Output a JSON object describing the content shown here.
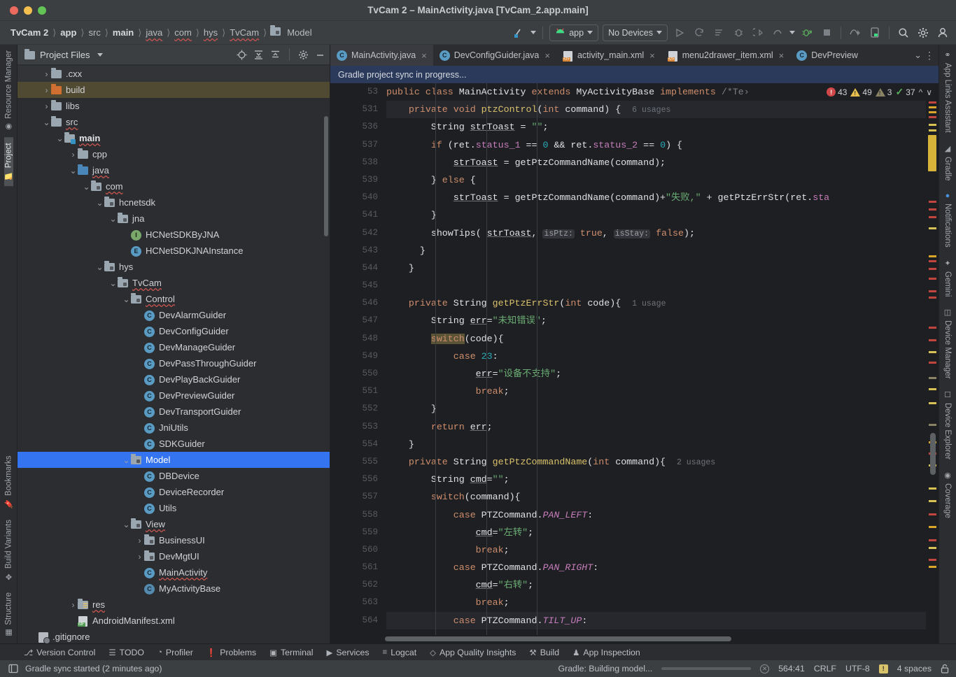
{
  "window": {
    "title": "TvCam 2 – MainActivity.java [TvCam_2.app.main]"
  },
  "breadcrumbs": [
    {
      "label": "TvCam 2",
      "bold": true,
      "squiggle": false
    },
    {
      "label": "app",
      "bold": true,
      "squiggle": false
    },
    {
      "label": "src",
      "bold": false,
      "squiggle": false
    },
    {
      "label": "main",
      "bold": true,
      "squiggle": false
    },
    {
      "label": "java",
      "bold": false,
      "squiggle": true
    },
    {
      "label": "com",
      "bold": false,
      "squiggle": true
    },
    {
      "label": "hys",
      "bold": false,
      "squiggle": true
    },
    {
      "label": "TvCam",
      "bold": false,
      "squiggle": true
    },
    {
      "label": "Model",
      "bold": false,
      "squiggle": false
    }
  ],
  "toolbar": {
    "run_config_label": "app",
    "device_label": "No Devices",
    "icons": [
      "git-branch-icon",
      "run-icon",
      "rerun-icon",
      "run-with-coverage-icon",
      "debug-icon",
      "profile-icon",
      "rollback-icon",
      "attach-debugger-icon",
      "stop-icon",
      "device-mirror-icon",
      "device-screenshot-icon",
      "search-icon",
      "gear-icon",
      "account-icon"
    ]
  },
  "project_panel": {
    "title": "Project Files",
    "header_icons": [
      "locate-icon",
      "expand-all-icon",
      "collapse-all-icon",
      "gear-icon",
      "minimize-icon"
    ],
    "tree": [
      {
        "depth": 3,
        "label": ".cxx",
        "icon": "folder",
        "arrow": "collapsed",
        "state": "hover"
      },
      {
        "depth": 3,
        "label": "build",
        "icon": "folder-orange",
        "arrow": "collapsed",
        "state": "build"
      },
      {
        "depth": 3,
        "label": "libs",
        "icon": "folder",
        "arrow": "collapsed",
        "state": ""
      },
      {
        "depth": 3,
        "label": "src",
        "icon": "folder",
        "arrow": "expanded",
        "state": "",
        "squiggle": true
      },
      {
        "depth": 4,
        "label": "main",
        "icon": "folder-main",
        "arrow": "expanded",
        "state": "",
        "bold": true,
        "squiggle": true
      },
      {
        "depth": 5,
        "label": "cpp",
        "icon": "folder",
        "arrow": "collapsed",
        "state": ""
      },
      {
        "depth": 5,
        "label": "java",
        "icon": "folder-blue",
        "arrow": "expanded",
        "state": "",
        "squiggle": true
      },
      {
        "depth": 6,
        "label": "com",
        "icon": "package",
        "arrow": "expanded",
        "state": "",
        "squiggle": true
      },
      {
        "depth": 7,
        "label": "hcnetsdk",
        "icon": "package",
        "arrow": "expanded",
        "state": ""
      },
      {
        "depth": 8,
        "label": "jna",
        "icon": "package",
        "arrow": "expanded",
        "state": ""
      },
      {
        "depth": 9,
        "label": "HCNetSDKByJNA",
        "icon": "interface",
        "arrow": "none",
        "state": ""
      },
      {
        "depth": 9,
        "label": "HCNetSDKJNAInstance",
        "icon": "enum",
        "arrow": "none",
        "state": ""
      },
      {
        "depth": 7,
        "label": "hys",
        "icon": "package",
        "arrow": "expanded",
        "state": ""
      },
      {
        "depth": 8,
        "label": "TvCam",
        "icon": "package",
        "arrow": "expanded",
        "state": "",
        "squiggle": true
      },
      {
        "depth": 9,
        "label": "Control",
        "icon": "package",
        "arrow": "expanded",
        "state": "",
        "squiggle": true
      },
      {
        "depth": 10,
        "label": "DevAlarmGuider",
        "icon": "class",
        "arrow": "none",
        "state": ""
      },
      {
        "depth": 10,
        "label": "DevConfigGuider",
        "icon": "class",
        "arrow": "none",
        "state": ""
      },
      {
        "depth": 10,
        "label": "DevManageGuider",
        "icon": "class",
        "arrow": "none",
        "state": ""
      },
      {
        "depth": 10,
        "label": "DevPassThroughGuider",
        "icon": "class",
        "arrow": "none",
        "state": ""
      },
      {
        "depth": 10,
        "label": "DevPlayBackGuider",
        "icon": "class",
        "arrow": "none",
        "state": ""
      },
      {
        "depth": 10,
        "label": "DevPreviewGuider",
        "icon": "class",
        "arrow": "none",
        "state": ""
      },
      {
        "depth": 10,
        "label": "DevTransportGuider",
        "icon": "class",
        "arrow": "none",
        "state": ""
      },
      {
        "depth": 10,
        "label": "JniUtils",
        "icon": "class",
        "arrow": "none",
        "state": ""
      },
      {
        "depth": 10,
        "label": "SDKGuider",
        "icon": "class",
        "arrow": "none",
        "state": ""
      },
      {
        "depth": 9,
        "label": "Model",
        "icon": "package",
        "arrow": "expanded",
        "state": "selected"
      },
      {
        "depth": 10,
        "label": "DBDevice",
        "icon": "class",
        "arrow": "none",
        "state": ""
      },
      {
        "depth": 10,
        "label": "DeviceRecorder",
        "icon": "class",
        "arrow": "none",
        "state": ""
      },
      {
        "depth": 10,
        "label": "Utils",
        "icon": "class",
        "arrow": "none",
        "state": ""
      },
      {
        "depth": 9,
        "label": "View",
        "icon": "package",
        "arrow": "expanded",
        "state": "",
        "squiggle": true
      },
      {
        "depth": 10,
        "label": "BusinessUI",
        "icon": "package",
        "arrow": "collapsed",
        "state": ""
      },
      {
        "depth": 10,
        "label": "DevMgtUI",
        "icon": "package",
        "arrow": "collapsed",
        "state": ""
      },
      {
        "depth": 10,
        "label": "MainActivity",
        "icon": "class",
        "arrow": "none",
        "state": "",
        "squiggle": true
      },
      {
        "depth": 10,
        "label": "MyActivityBase",
        "icon": "abstract-class",
        "arrow": "none",
        "state": ""
      },
      {
        "depth": 5,
        "label": "res",
        "icon": "res-folder",
        "arrow": "collapsed",
        "state": "",
        "squiggle": true
      },
      {
        "depth": 5,
        "label": "AndroidManifest.xml",
        "icon": "manifest",
        "arrow": "none",
        "state": ""
      },
      {
        "depth": 2,
        "label": ".gitignore",
        "icon": "gitignore",
        "arrow": "none",
        "state": ""
      }
    ]
  },
  "editor": {
    "tabs": [
      {
        "label": "MainActivity.java",
        "icon": "java-class-icon",
        "active": true,
        "closable": true
      },
      {
        "label": "DevConfigGuider.java",
        "icon": "java-class-icon",
        "active": false,
        "closable": true
      },
      {
        "label": "activity_main.xml",
        "icon": "xml-layout-icon",
        "active": false,
        "closable": true
      },
      {
        "label": "menu2drawer_item.xml",
        "icon": "xml-layout-icon",
        "active": false,
        "closable": true
      },
      {
        "label": "DevPreview",
        "icon": "java-class-icon",
        "active": false,
        "closable": false
      }
    ],
    "tabs_overflow_icon": "chevron-down-icon",
    "tabs_more_icon": "more-options-icon",
    "sync_banner": "Gradle project sync in progress...",
    "inspections": {
      "errors": "43",
      "warnings": "49",
      "weak_warnings": "3",
      "checks": "37"
    },
    "lines": [
      {
        "n": "53",
        "fold": "",
        "hl": false,
        "type": "class_decl"
      },
      {
        "n": "531",
        "fold": "open",
        "hl": true,
        "type": "ptzControl"
      },
      {
        "n": "536",
        "fold": "",
        "hl": false,
        "type": "strToast_decl"
      },
      {
        "n": "537",
        "fold": "open",
        "hl": false,
        "type": "if_ret"
      },
      {
        "n": "538",
        "fold": "",
        "hl": false,
        "type": "assign_cmdname"
      },
      {
        "n": "539",
        "fold": "close",
        "hl": false,
        "type": "else"
      },
      {
        "n": "540",
        "fold": "",
        "hl": false,
        "type": "assign_fail"
      },
      {
        "n": "541",
        "fold": "close",
        "hl": false,
        "type": "brace"
      },
      {
        "n": "542",
        "fold": "",
        "hl": false,
        "type": "showtips"
      },
      {
        "n": "543",
        "fold": "close",
        "hl": false,
        "type": "brace2"
      },
      {
        "n": "544",
        "fold": "close",
        "hl": false,
        "type": "brace3"
      },
      {
        "n": "545",
        "fold": "",
        "hl": false,
        "type": "blank"
      },
      {
        "n": "546",
        "fold": "open",
        "hl": false,
        "type": "getPtzErrStr"
      },
      {
        "n": "547",
        "fold": "",
        "hl": false,
        "type": "err_decl"
      },
      {
        "n": "548",
        "fold": "open",
        "hl": false,
        "type": "switch_code"
      },
      {
        "n": "549",
        "fold": "",
        "hl": false,
        "type": "case23"
      },
      {
        "n": "550",
        "fold": "",
        "hl": false,
        "type": "err_assign"
      },
      {
        "n": "551",
        "fold": "",
        "hl": false,
        "type": "break1"
      },
      {
        "n": "552",
        "fold": "close",
        "hl": false,
        "type": "brace4"
      },
      {
        "n": "553",
        "fold": "",
        "hl": false,
        "type": "return_err"
      },
      {
        "n": "554",
        "fold": "close",
        "hl": false,
        "type": "brace5"
      },
      {
        "n": "555",
        "fold": "open",
        "hl": false,
        "type": "getPtzCommandName"
      },
      {
        "n": "556",
        "fold": "",
        "hl": false,
        "type": "cmd_decl"
      },
      {
        "n": "557",
        "fold": "open",
        "hl": false,
        "type": "switch_command"
      },
      {
        "n": "558",
        "fold": "",
        "hl": false,
        "type": "case_pan_left"
      },
      {
        "n": "559",
        "fold": "",
        "hl": false,
        "type": "cmd_left"
      },
      {
        "n": "560",
        "fold": "",
        "hl": false,
        "type": "break2"
      },
      {
        "n": "561",
        "fold": "",
        "hl": false,
        "type": "case_pan_right"
      },
      {
        "n": "562",
        "fold": "",
        "hl": false,
        "type": "cmd_right"
      },
      {
        "n": "563",
        "fold": "",
        "hl": false,
        "type": "break3"
      },
      {
        "n": "564",
        "fold": "",
        "hl": true,
        "type": "case_tilt_up"
      }
    ],
    "code_text": {
      "l53": "public class MainActivity extends MyActivityBase implements /*Te›",
      "l531": "private void ptzControl(int command) {",
      "l531_usage": "6 usages",
      "l536": "String strToast = \"\";",
      "l537": "if (ret.status_1 == 0 && ret.status_2 == 0) {",
      "l538": "strToast = getPtzCommandName(command);",
      "l539": "} else {",
      "l540": "strToast = getPtzCommandName(command)+\"失败,\" + getPtzErrStr(ret.sta",
      "l541": "}",
      "l542": "showTips( strToast, isPtz: true, isStay: false);",
      "l543": "}",
      "l544": "}",
      "l546": "private String getPtzErrStr(int code){",
      "l546_usage": "1 usage",
      "l547": "String err=\"未知错误\";",
      "l548": "switch(code){",
      "l549": "case 23:",
      "l550": "err=\"设备不支持\";",
      "l551": "break;",
      "l552": "}",
      "l553": "return err;",
      "l554": "}",
      "l555": "private String getPtzCommandName(int command){",
      "l555_usage": "2 usages",
      "l556": "String cmd=\"\";",
      "l557": "switch(command){",
      "l558": "case PTZCommand.PAN_LEFT:",
      "l559": "cmd=\"左转\";",
      "l560": "break;",
      "l561": "case PTZCommand.PAN_RIGHT:",
      "l562": "cmd=\"右转\";",
      "l563": "break;",
      "l564": "case PTZCommand.TILT_UP:"
    }
  },
  "left_strip": {
    "top": [
      {
        "label": "Resource Manager",
        "icon": "resource-manager-icon",
        "active": false
      },
      {
        "label": "Project",
        "icon": "project-folder-icon",
        "active": true
      }
    ],
    "bottom": [
      {
        "label": "Bookmarks",
        "icon": "bookmark-icon",
        "active": false
      },
      {
        "label": "Build Variants",
        "icon": "build-variants-icon",
        "active": false
      },
      {
        "label": "Structure",
        "icon": "structure-icon",
        "active": false
      }
    ]
  },
  "right_strip": {
    "items": [
      {
        "label": "App Links Assistant",
        "icon": "app-links-icon"
      },
      {
        "label": "Gradle",
        "icon": "gradle-elephant-icon"
      },
      {
        "label": "Notifications",
        "icon": "notifications-bell-icon"
      },
      {
        "label": "Gemini",
        "icon": "gemini-sparkle-icon"
      },
      {
        "label": "Device Manager",
        "icon": "device-manager-icon"
      },
      {
        "label": "Device Explorer",
        "icon": "device-explorer-icon"
      },
      {
        "label": "Coverage",
        "icon": "coverage-shield-icon"
      }
    ]
  },
  "tool_windows": [
    {
      "label": "Version Control",
      "icon": "vcs-branch-icon"
    },
    {
      "label": "TODO",
      "icon": "todo-list-icon"
    },
    {
      "label": "Profiler",
      "icon": "profiler-gauge-icon"
    },
    {
      "label": "Problems",
      "icon": "problems-exclaim-icon"
    },
    {
      "label": "Terminal",
      "icon": "terminal-icon"
    },
    {
      "label": "Services",
      "icon": "services-play-icon"
    },
    {
      "label": "Logcat",
      "icon": "logcat-lines-icon"
    },
    {
      "label": "App Quality Insights",
      "icon": "diamond-icon"
    },
    {
      "label": "Build",
      "icon": "build-hammer-icon"
    },
    {
      "label": "App Inspection",
      "icon": "app-inspection-icon"
    }
  ],
  "status_bar": {
    "left_icon": "toggle-toolwindows-icon",
    "message": "Gradle sync started (2 minutes ago)",
    "progress_label": "Gradle: Building model...",
    "cancel_icon": "cancel-circle-icon",
    "caret_position": "564:41",
    "line_separator": "CRLF",
    "encoding": "UTF-8",
    "indent": "4 spaces",
    "lock_icon": "write-access-lock-icon",
    "warning_icon": "warning-square-icon"
  },
  "colors": {
    "accent_blue": "#3574f0",
    "banner_blue": "#2b3a5b",
    "error_red": "#d1484b",
    "warning_yellow": "#e8bf4e",
    "ok_green": "#5aad5a",
    "build_highlight": "#514a32",
    "editor_bg": "#1e1f22",
    "panel_bg": "#2b2d30",
    "toolbar_bg": "#3c3f41"
  }
}
